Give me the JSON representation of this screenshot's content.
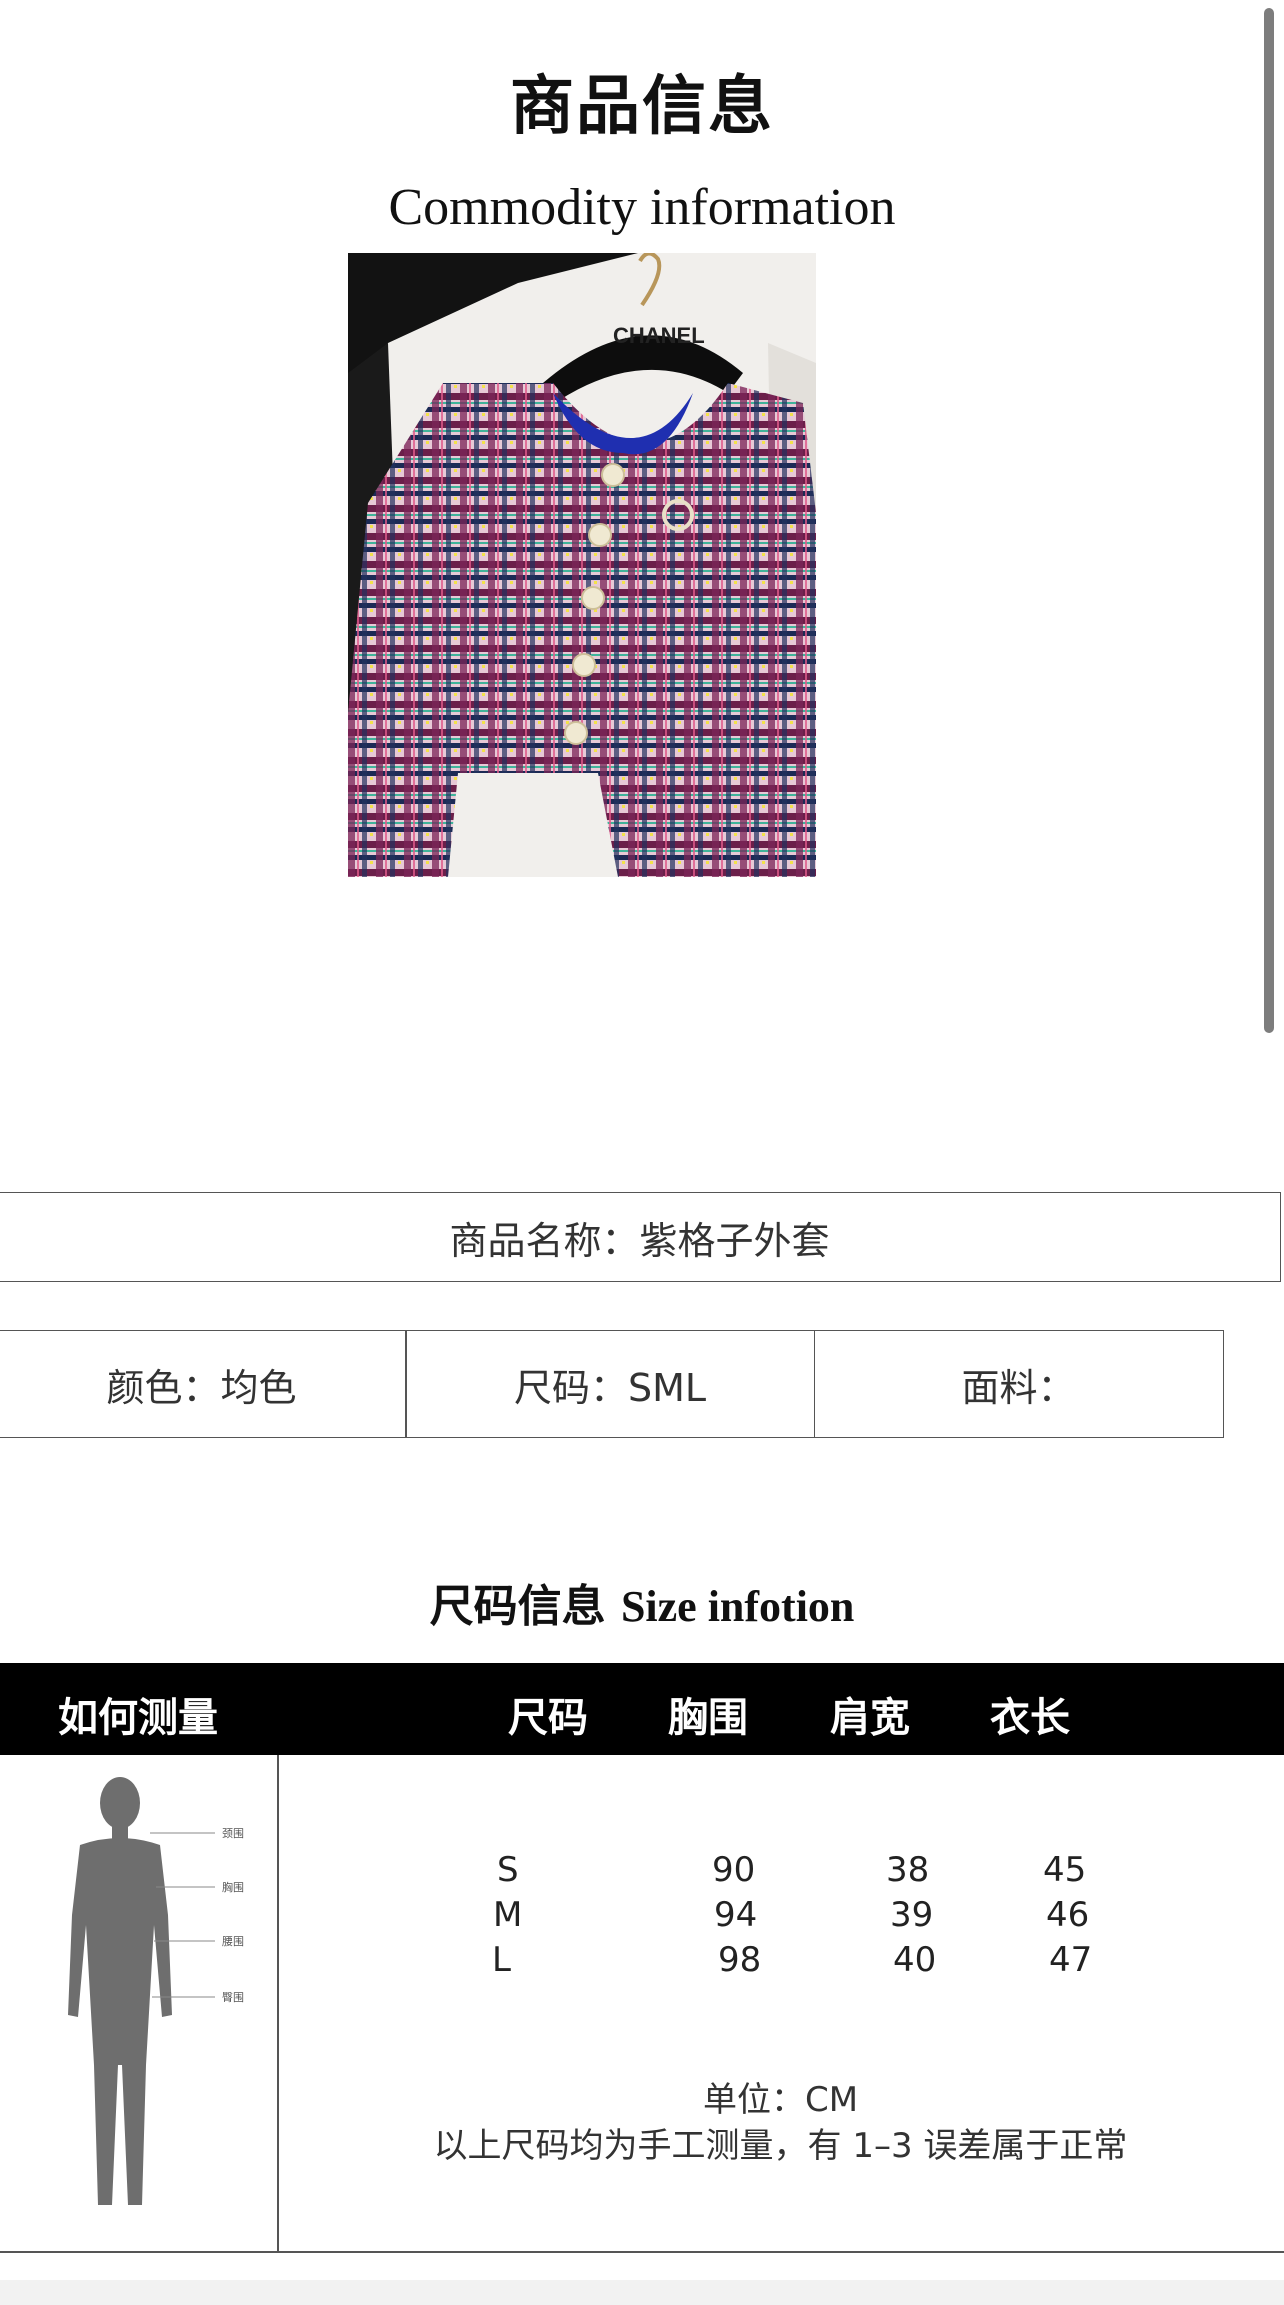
{
  "header": {
    "title_cn": "商品信息",
    "title_en": "Commodity information"
  },
  "product_image": {
    "brand_text": "CHANEL",
    "description": "purple plaid tweed jacket on hanger"
  },
  "product": {
    "name_label": "商品名称：",
    "name_value": "紫格子外套",
    "color": "颜色：均色",
    "size": "尺码：SML",
    "fabric": "面料："
  },
  "size_info": {
    "title_cn": "尺码信息",
    "title_en": "Size infotion",
    "head": {
      "how_to": "如何测量",
      "size": "尺码",
      "chest": "胸围",
      "shoulder": "肩宽",
      "length": "衣长"
    },
    "rows": [
      {
        "size": "S",
        "chest": "90",
        "shoulder": "38",
        "length": "45"
      },
      {
        "size": "M",
        "chest": "94",
        "shoulder": "39",
        "length": "46"
      },
      {
        "size": "L",
        "chest": "98",
        "shoulder": "40",
        "length": "47"
      }
    ],
    "measure_labels": [
      "颈围",
      "胸围",
      "腰围",
      "臀围"
    ],
    "unit": "单位：CM",
    "note": "以上尺码均为手工测量，有 1–3 误差属于正常"
  },
  "colors": {
    "table_header_bg": "#000000",
    "figure": "#6e6e6e"
  }
}
